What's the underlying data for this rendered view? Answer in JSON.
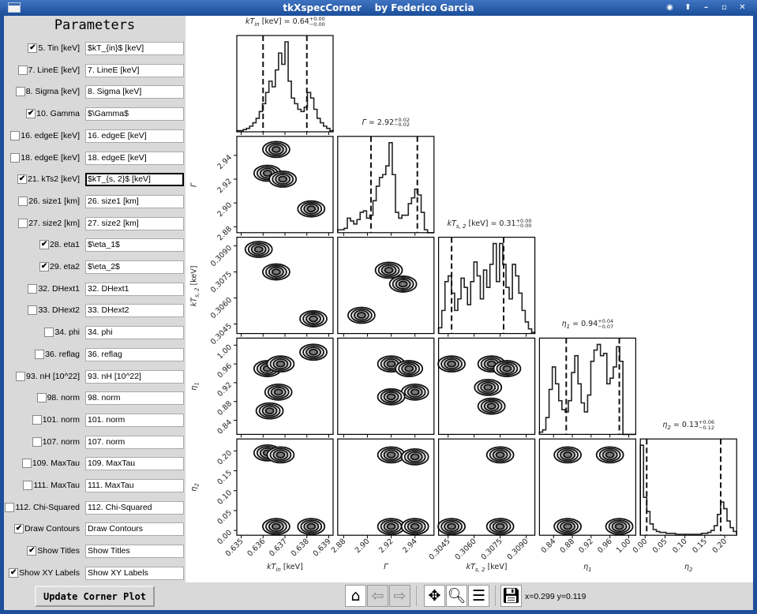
{
  "window": {
    "title": "tkXspecCorner    by Federico Garcia",
    "buttons": [
      "◉",
      "⬆",
      "–",
      "▫",
      "✕"
    ]
  },
  "panel": {
    "heading": "Parameters",
    "params": [
      {
        "label": "5. Tin [keV]",
        "checked": true,
        "value": "$kT_{in}$ [keV]"
      },
      {
        "label": "7. LineE [keV]",
        "checked": false,
        "value": "7. LineE [keV]"
      },
      {
        "label": "8. Sigma [keV]",
        "checked": false,
        "value": "8. Sigma [keV]"
      },
      {
        "label": "10. Gamma",
        "checked": true,
        "value": "$\\Gamma$"
      },
      {
        "label": "16. edgeE [keV]",
        "checked": false,
        "value": "16. edgeE [keV]"
      },
      {
        "label": "18. edgeE [keV]",
        "checked": false,
        "value": "18. edgeE [keV]"
      },
      {
        "label": "21. kTs2 [keV]",
        "checked": true,
        "value": "$kT_{s, 2}$ [keV]",
        "focused": true
      },
      {
        "label": "26. size1 [km]",
        "checked": false,
        "value": "26. size1 [km]"
      },
      {
        "label": "27. size2 [km]",
        "checked": false,
        "value": "27. size2 [km]"
      },
      {
        "label": "28. eta1",
        "checked": true,
        "value": "$\\eta_1$"
      },
      {
        "label": "29. eta2",
        "checked": true,
        "value": "$\\eta_2$"
      },
      {
        "label": "32. DHext1",
        "checked": false,
        "value": "32. DHext1"
      },
      {
        "label": "33. DHext2",
        "checked": false,
        "value": "33. DHext2"
      },
      {
        "label": "34. phi",
        "checked": false,
        "value": "34. phi"
      },
      {
        "label": "36. reflag",
        "checked": false,
        "value": "36. reflag"
      },
      {
        "label": "93. nH [10^22]",
        "checked": false,
        "value": "93. nH [10^22]"
      },
      {
        "label": "98. norm",
        "checked": false,
        "value": "98. norm"
      },
      {
        "label": "101. norm",
        "checked": false,
        "value": "101. norm"
      },
      {
        "label": "107. norm",
        "checked": false,
        "value": "107. norm"
      },
      {
        "label": "109. MaxTau",
        "checked": false,
        "value": "109. MaxTau"
      },
      {
        "label": "111. MaxTau",
        "checked": false,
        "value": "111. MaxTau"
      },
      {
        "label": "112. Chi-Squared",
        "checked": false,
        "value": "112. Chi-Squared"
      },
      {
        "label": "Draw Contours",
        "checked": true,
        "value": "Draw Contours"
      },
      {
        "label": "Show Titles",
        "checked": true,
        "value": "Show Titles"
      },
      {
        "label": "Show XY Labels",
        "checked": true,
        "value": "Show XY Labels"
      }
    ],
    "update_label": "Update Corner Plot"
  },
  "toolbar": {
    "icons": [
      "home-icon",
      "back-icon",
      "forward-icon",
      "pan-icon",
      "zoom-icon",
      "configure-icon",
      "save-icon"
    ],
    "coords": "x=0.299 y=0.119"
  },
  "chart_data": {
    "type": "corner",
    "params": [
      {
        "sym": "kT",
        "sub": "in",
        "unit": " [keV]",
        "value": "0.64",
        "plus": "+0.00",
        "minus": "−0.00",
        "range": [
          0.6348,
          0.6392
        ],
        "ticks": [
          "0.635",
          "0.636",
          "0.637",
          "0.638",
          "0.639"
        ],
        "quantiles": [
          0.636,
          0.638
        ],
        "hist": [
          1,
          1,
          2,
          3,
          5,
          8,
          12,
          18,
          25,
          35,
          45,
          40,
          55,
          70,
          60,
          80,
          45,
          30,
          25,
          20,
          18,
          22,
          35,
          30,
          20,
          12,
          8,
          5,
          3,
          1
        ]
      },
      {
        "sym": "Γ",
        "sub": "",
        "unit": "",
        "value": "2.92",
        "plus": "+0.02",
        "minus": "−0.02",
        "range": [
          2.875,
          2.956
        ],
        "ticks": [
          "2.88",
          "2.90",
          "2.92",
          "2.94"
        ],
        "quantiles": [
          2.903,
          2.942
        ],
        "hist": [
          2,
          2,
          3,
          10,
          8,
          6,
          9,
          14,
          15,
          10,
          12,
          22,
          32,
          38,
          40,
          46,
          62,
          40,
          14,
          10,
          12,
          12,
          20,
          24,
          30,
          26,
          14,
          2,
          0,
          0
        ]
      },
      {
        "sym": "kT",
        "sub": "s, 2",
        "unit": " [keV]",
        "value": "0.31",
        "plus": "+0.00",
        "minus": "−0.00",
        "range": [
          0.30395,
          0.3095
        ],
        "ticks": [
          "0.3045",
          "0.3060",
          "0.3075",
          "0.3090"
        ],
        "quantiles": [
          0.3047,
          0.3077
        ],
        "hist": [
          5,
          20,
          45,
          50,
          35,
          20,
          30,
          48,
          40,
          25,
          45,
          62,
          50,
          30,
          55,
          40,
          60,
          78,
          45,
          78,
          60,
          40,
          30,
          60,
          50,
          35,
          20,
          10,
          4,
          1
        ]
      },
      {
        "sym": "η",
        "sub": "1",
        "unit": "",
        "value": "0.94",
        "plus": "+0.04",
        "minus": "−0.07",
        "range": [
          0.81,
          1.015
        ],
        "ticks": [
          "0.84",
          "0.88",
          "0.92",
          "0.96",
          "1.00"
        ],
        "quantiles": [
          0.867,
          0.98
        ],
        "hist": [
          2,
          4,
          15,
          40,
          60,
          45,
          30,
          22,
          20,
          30,
          55,
          70,
          45,
          28,
          20,
          35,
          65,
          75,
          80,
          70,
          72,
          45,
          50,
          60,
          78,
          65,
          0,
          0,
          0,
          0
        ]
      },
      {
        "sym": "η",
        "sub": "2",
        "unit": "",
        "value": "0.13",
        "plus": "+0.06",
        "minus": "−0.12",
        "range": [
          -0.012,
          0.23
        ],
        "ticks": [
          "0.00",
          "0.05",
          "0.10",
          "0.15",
          "0.20"
        ],
        "quantiles": [
          0.004,
          0.19
        ],
        "hist": [
          95,
          40,
          25,
          12,
          6,
          4,
          3,
          3,
          2,
          2,
          2,
          1,
          1,
          1,
          1,
          1,
          1,
          1,
          1,
          2,
          2,
          3,
          5,
          10,
          22,
          35,
          28,
          15,
          8,
          4
        ]
      }
    ],
    "yticks": {
      "1": [
        "2.88",
        "2.90",
        "2.92",
        "2.94"
      ],
      "2": [
        "0.3045",
        "0.3060",
        "0.3075",
        "0.3090"
      ],
      "3": [
        "0.84",
        "0.88",
        "0.92",
        "0.96",
        "1.00"
      ],
      "4": [
        "0.00",
        "0.05",
        "0.10",
        "0.15",
        "0.20"
      ]
    },
    "density_peaks": {
      "0-1": [
        [
          0.6362,
          2.925
        ],
        [
          0.6369,
          2.92
        ],
        [
          0.6382,
          2.895
        ],
        [
          0.6366,
          2.945
        ]
      ],
      "0-2": [
        [
          0.6358,
          0.3088
        ],
        [
          0.6366,
          0.3075
        ],
        [
          0.6383,
          0.3048
        ]
      ],
      "0-3": [
        [
          0.6362,
          0.95
        ],
        [
          0.6368,
          0.96
        ],
        [
          0.6383,
          0.985
        ],
        [
          0.6367,
          0.9
        ],
        [
          0.6363,
          0.86
        ]
      ],
      "0-4": [
        [
          0.6362,
          0.195
        ],
        [
          0.6368,
          0.19
        ],
        [
          0.6366,
          0.01
        ],
        [
          0.6382,
          0.01
        ]
      ],
      "1-2": [
        [
          2.918,
          0.3076
        ],
        [
          2.93,
          0.3068
        ],
        [
          2.895,
          0.305
        ]
      ],
      "1-3": [
        [
          2.92,
          0.96
        ],
        [
          2.935,
          0.95
        ],
        [
          2.94,
          0.9
        ],
        [
          2.92,
          0.89
        ]
      ],
      "1-4": [
        [
          2.92,
          0.19
        ],
        [
          2.94,
          0.185
        ],
        [
          2.92,
          0.01
        ],
        [
          2.94,
          0.01
        ]
      ],
      "2-3": [
        [
          0.3047,
          0.96
        ],
        [
          0.307,
          0.96
        ],
        [
          0.3079,
          0.95
        ],
        [
          0.3068,
          0.91
        ],
        [
          0.307,
          0.87
        ]
      ],
      "2-4": [
        [
          0.3075,
          0.19
        ],
        [
          0.3047,
          0.01
        ],
        [
          0.3075,
          0.01
        ]
      ],
      "3-4": [
        [
          0.87,
          0.19
        ],
        [
          0.96,
          0.19
        ],
        [
          0.87,
          0.01
        ],
        [
          0.98,
          0.01
        ]
      ]
    }
  }
}
